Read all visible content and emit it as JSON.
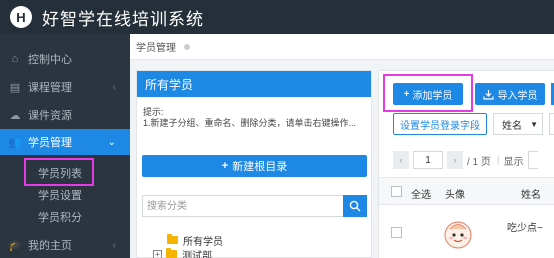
{
  "app": {
    "logo_letter": "H",
    "title": "好智学在线培训系统"
  },
  "sidebar": {
    "items": [
      {
        "label": "控制中心",
        "icon": "home-icon"
      },
      {
        "label": "课程管理",
        "icon": "book-icon"
      },
      {
        "label": "课件资源",
        "icon": "cloud-icon"
      },
      {
        "label": "学员管理",
        "icon": "users-icon"
      },
      {
        "label": "我的主页",
        "icon": "grad-cap-icon"
      }
    ],
    "sub_items": [
      {
        "label": "学员列表"
      },
      {
        "label": "学员设置"
      },
      {
        "label": "学员积分"
      }
    ]
  },
  "breadcrumb": {
    "current": "学员管理"
  },
  "left_panel": {
    "title": "所有学员",
    "tip_title": "提示:",
    "tip_text": "1.新建子分组、重命名、删除分类，请单击右键操作...",
    "new_root_label": "新建根目录",
    "search_placeholder": "搜索分类",
    "tree": [
      {
        "label": "所有学员"
      },
      {
        "label": "测试部"
      }
    ]
  },
  "right_panel": {
    "add_label": "添加学员",
    "import_label": "导入学员",
    "set_login_field_label": "设置学员登录字段",
    "name_select": "姓名",
    "pager": {
      "page": "1",
      "total_text": "/ 1 页",
      "display_label": "显示"
    },
    "columns": {
      "select_all": "全选",
      "avatar": "头像",
      "name": "姓名"
    },
    "rows": [
      {
        "name": "吃少点~"
      }
    ]
  },
  "colors": {
    "accent": "#1e88e5",
    "highlight": "#e43de6",
    "topbar": "#242f3a",
    "sidebar": "#2a3540"
  }
}
